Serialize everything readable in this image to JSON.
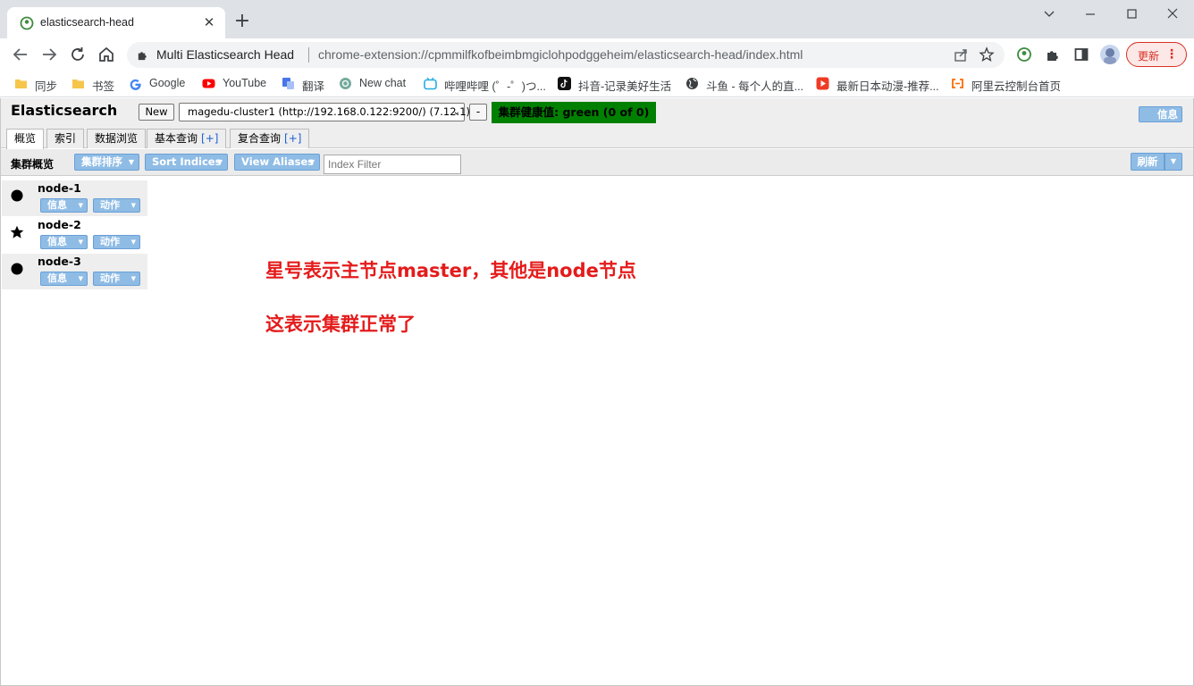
{
  "browser": {
    "tab_title": "elasticsearch-head",
    "site_name": "Multi Elasticsearch Head",
    "url": "chrome-extension://cpmmilfkofbeimbmgiclohpodggeheim/elasticsearch-head/index.html",
    "update_label": "更新",
    "bookmarks": [
      {
        "label": "同步",
        "icon": "folder-icon"
      },
      {
        "label": "书签",
        "icon": "folder-icon"
      },
      {
        "label": "Google",
        "icon": "google-icon"
      },
      {
        "label": "YouTube",
        "icon": "youtube-icon"
      },
      {
        "label": "翻译",
        "icon": "translate-icon"
      },
      {
        "label": "New chat",
        "icon": "chatgpt-icon"
      },
      {
        "label": "哔哩哔哩 (゜-゜)つ...",
        "icon": "bilibili-icon"
      },
      {
        "label": "抖音-记录美好生活",
        "icon": "tiktok-icon"
      },
      {
        "label": "斗鱼 - 每个人的直...",
        "icon": "globe-icon"
      },
      {
        "label": "最新日本动漫-推荐...",
        "icon": "video-icon"
      },
      {
        "label": "阿里云控制台首页",
        "icon": "aliyun-icon"
      }
    ]
  },
  "app": {
    "title": "Elasticsearch",
    "new_button": "New",
    "cluster_select": "magedu-cluster1 (http://192.168.0.122:9200/) (7.12.1)",
    "minus_button": "-",
    "health": "集群健康值: green (0 of 0)",
    "health_color": "#008000",
    "info_button": "信息",
    "tabs": [
      {
        "label": "概览",
        "plus": ""
      },
      {
        "label": "索引",
        "plus": ""
      },
      {
        "label": "数据浏览",
        "plus": ""
      },
      {
        "label": "基本查询",
        "plus": "[+]"
      },
      {
        "label": "复合查询",
        "plus": "[+]"
      }
    ],
    "overview": {
      "label": "集群概览",
      "sort_cluster": "集群排序",
      "sort_indices": "Sort Indices",
      "view_aliases": "View Aliases",
      "index_filter_placeholder": "Index Filter",
      "refresh": "刷新"
    },
    "nodes": [
      {
        "name": "node-1",
        "role_icon": "circle-icon",
        "info": "信息",
        "action": "动作"
      },
      {
        "name": "node-2",
        "role_icon": "star-icon",
        "info": "信息",
        "action": "动作"
      },
      {
        "name": "node-3",
        "role_icon": "circle-icon",
        "info": "信息",
        "action": "动作"
      }
    ]
  },
  "annotations": {
    "line1": "星号表示主节点master，其他是node节点",
    "line2": "这表示集群正常了",
    "color": "#e41b1b"
  }
}
